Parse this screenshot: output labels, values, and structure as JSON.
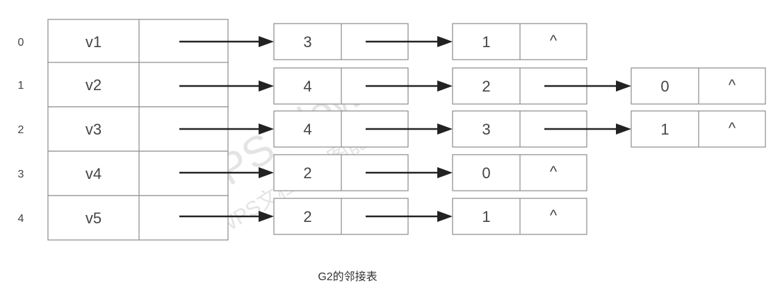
{
  "caption": "G2的邻接表",
  "watermark": {
    "line1": "WPS Flow",
    "line2": "WPS文档协作图能力"
  },
  "end_marker": "^",
  "vertices": [
    {
      "index": "0",
      "name": "v1",
      "edges": [
        "3",
        "1"
      ]
    },
    {
      "index": "1",
      "name": "v2",
      "edges": [
        "4",
        "2",
        "0"
      ]
    },
    {
      "index": "2",
      "name": "v3",
      "edges": [
        "4",
        "3",
        "1"
      ]
    },
    {
      "index": "3",
      "name": "v4",
      "edges": [
        "2",
        "0"
      ]
    },
    {
      "index": "4",
      "name": "v5",
      "edges": [
        "2",
        "1"
      ]
    }
  ]
}
